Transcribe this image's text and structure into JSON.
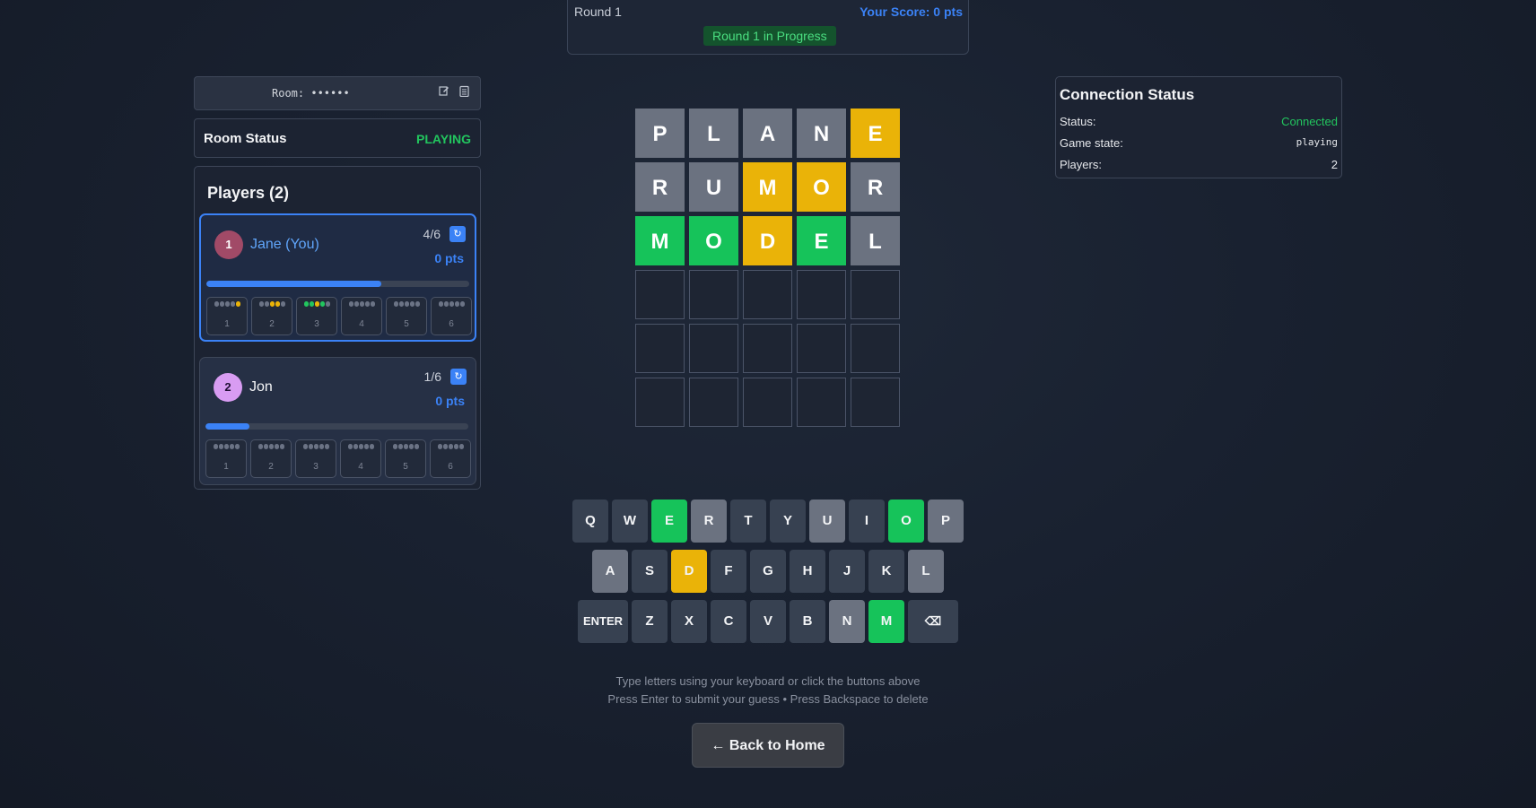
{
  "round": {
    "label": "Round 1",
    "score": "Your Score: 0 pts",
    "badge": "Round 1 in Progress"
  },
  "room": {
    "label": "Room:",
    "code": "••••••",
    "edit_icon": "edit-icon",
    "copy_icon": "clipboard-icon"
  },
  "room_status": {
    "label": "Room Status",
    "value": "PLAYING"
  },
  "players": {
    "title": "Players (2)",
    "list": [
      {
        "rank": "1",
        "name": "Jane (You)",
        "progress_text": "4/6",
        "points": "0 pts",
        "progress": 0.667,
        "avatar_color": "#a14a67",
        "avatar_text_color": "#ffffff",
        "rows": [
          {
            "num": "1",
            "dots": [
              "n",
              "n",
              "n",
              "n",
              "y"
            ]
          },
          {
            "num": "2",
            "dots": [
              "n",
              "n",
              "y",
              "y",
              "n"
            ]
          },
          {
            "num": "3",
            "dots": [
              "g",
              "g",
              "y",
              "g",
              "n"
            ]
          },
          {
            "num": "4",
            "dots": [
              "n",
              "n",
              "n",
              "n",
              "n"
            ]
          },
          {
            "num": "5",
            "dots": [
              "n",
              "n",
              "n",
              "n",
              "n"
            ]
          },
          {
            "num": "6",
            "dots": [
              "n",
              "n",
              "n",
              "n",
              "n"
            ]
          }
        ]
      },
      {
        "rank": "2",
        "name": "Jon",
        "progress_text": "1/6",
        "points": "0 pts",
        "progress": 0.167,
        "avatar_color": "#d89cf2",
        "avatar_text_color": "#1f1033",
        "rows": [
          {
            "num": "1",
            "dots": [
              "n",
              "n",
              "n",
              "n",
              "n"
            ]
          },
          {
            "num": "2",
            "dots": [
              "n",
              "n",
              "n",
              "n",
              "n"
            ]
          },
          {
            "num": "3",
            "dots": [
              "n",
              "n",
              "n",
              "n",
              "n"
            ]
          },
          {
            "num": "4",
            "dots": [
              "n",
              "n",
              "n",
              "n",
              "n"
            ]
          },
          {
            "num": "5",
            "dots": [
              "n",
              "n",
              "n",
              "n",
              "n"
            ]
          },
          {
            "num": "6",
            "dots": [
              "n",
              "n",
              "n",
              "n",
              "n"
            ]
          }
        ]
      }
    ]
  },
  "board": [
    [
      {
        "l": "P",
        "s": "gray"
      },
      {
        "l": "L",
        "s": "gray"
      },
      {
        "l": "A",
        "s": "gray"
      },
      {
        "l": "N",
        "s": "gray"
      },
      {
        "l": "E",
        "s": "yellow"
      }
    ],
    [
      {
        "l": "R",
        "s": "gray"
      },
      {
        "l": "U",
        "s": "gray"
      },
      {
        "l": "M",
        "s": "yellow"
      },
      {
        "l": "O",
        "s": "yellow"
      },
      {
        "l": "R",
        "s": "gray"
      }
    ],
    [
      {
        "l": "M",
        "s": "green"
      },
      {
        "l": "O",
        "s": "green"
      },
      {
        "l": "D",
        "s": "yellow"
      },
      {
        "l": "E",
        "s": "green"
      },
      {
        "l": "L",
        "s": "gray"
      }
    ],
    [
      {
        "l": "",
        "s": "empty"
      },
      {
        "l": "",
        "s": "empty"
      },
      {
        "l": "",
        "s": "empty"
      },
      {
        "l": "",
        "s": "empty"
      },
      {
        "l": "",
        "s": "empty"
      }
    ],
    [
      {
        "l": "",
        "s": "empty"
      },
      {
        "l": "",
        "s": "empty"
      },
      {
        "l": "",
        "s": "empty"
      },
      {
        "l": "",
        "s": "empty"
      },
      {
        "l": "",
        "s": "empty"
      }
    ],
    [
      {
        "l": "",
        "s": "empty"
      },
      {
        "l": "",
        "s": "empty"
      },
      {
        "l": "",
        "s": "empty"
      },
      {
        "l": "",
        "s": "empty"
      },
      {
        "l": "",
        "s": "empty"
      }
    ]
  ],
  "keyboard": [
    [
      {
        "k": "Q",
        "s": ""
      },
      {
        "k": "W",
        "s": ""
      },
      {
        "k": "E",
        "s": "green"
      },
      {
        "k": "R",
        "s": "gray"
      },
      {
        "k": "T",
        "s": ""
      },
      {
        "k": "Y",
        "s": ""
      },
      {
        "k": "U",
        "s": "gray"
      },
      {
        "k": "I",
        "s": ""
      },
      {
        "k": "O",
        "s": "green"
      },
      {
        "k": "P",
        "s": "gray"
      }
    ],
    [
      {
        "k": "A",
        "s": "gray"
      },
      {
        "k": "S",
        "s": ""
      },
      {
        "k": "D",
        "s": "yellow"
      },
      {
        "k": "F",
        "s": ""
      },
      {
        "k": "G",
        "s": ""
      },
      {
        "k": "H",
        "s": ""
      },
      {
        "k": "J",
        "s": ""
      },
      {
        "k": "K",
        "s": ""
      },
      {
        "k": "L",
        "s": "gray"
      }
    ],
    [
      {
        "k": "ENTER",
        "s": "",
        "wide": true
      },
      {
        "k": "Z",
        "s": ""
      },
      {
        "k": "X",
        "s": ""
      },
      {
        "k": "C",
        "s": ""
      },
      {
        "k": "V",
        "s": ""
      },
      {
        "k": "B",
        "s": ""
      },
      {
        "k": "N",
        "s": "gray"
      },
      {
        "k": "M",
        "s": "green"
      },
      {
        "k": "⌫",
        "s": "",
        "wide": true
      }
    ]
  ],
  "hints": {
    "line1": "Type letters using your keyboard or click the buttons above",
    "line2": "Press Enter to submit your guess • Press Backspace to delete"
  },
  "back_button": "← Back to Home",
  "connection": {
    "title": "Connection Status",
    "status_label": "Status:",
    "status_value": "Connected",
    "game_label": "Game state:",
    "game_value": "playing",
    "players_label": "Players:",
    "players_value": "2"
  }
}
